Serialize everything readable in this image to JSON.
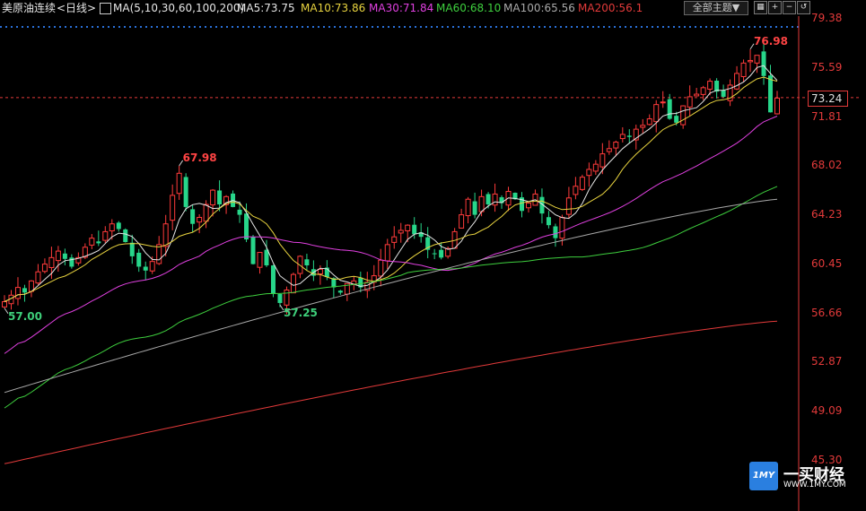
{
  "header": {
    "instrument": "美原油连续",
    "period": "<日线>",
    "ma_label": "MA(5,10,30,60,100,200)",
    "ma_values": [
      {
        "text": "MA5:73.75",
        "color": "#e6e6e6"
      },
      {
        "text": "MA10:73.86",
        "color": "#e8d33f"
      },
      {
        "text": "MA30:71.84",
        "color": "#e040e0"
      },
      {
        "text": "MA60:68.10",
        "color": "#3ecf3e"
      },
      {
        "text": "MA100:65.56",
        "color": "#a8a8a8"
      },
      {
        "text": "MA200:56.1",
        "color": "#e23a3a"
      }
    ],
    "theme_button": "全部主题▼",
    "tool_icons": [
      "grid-icon",
      "zoom-in-icon",
      "zoom-out-icon",
      "reset-icon"
    ]
  },
  "chart_data": {
    "type": "candlestick",
    "y_axis": {
      "ticks": [
        "79.38",
        "75.59",
        "71.81",
        "68.02",
        "64.23",
        "60.45",
        "56.66",
        "52.87",
        "49.09",
        "45.30"
      ],
      "range": [
        45.3,
        79.38
      ]
    },
    "current_price": "73.24",
    "current_value": 73.24,
    "annotations": [
      {
        "label": "76.98",
        "value": 76.98,
        "color": "#ff4444"
      },
      {
        "label": "67.98",
        "value": 67.98,
        "color": "#ff4444"
      },
      {
        "label": "57.25",
        "value": 57.25,
        "color": "#3ecf7a"
      },
      {
        "label": "57.00",
        "value": 57.0,
        "color": "#3ecf7a"
      }
    ],
    "up_color": "#ff3b3b",
    "down_color": "#27d68a",
    "closes": [
      57.5,
      58.0,
      58.6,
      58.2,
      59.1,
      59.8,
      60.4,
      60.9,
      61.4,
      60.8,
      60.2,
      60.9,
      61.7,
      62.4,
      62.0,
      62.9,
      63.5,
      63.1,
      62.1,
      61.0,
      60.2,
      59.9,
      60.6,
      61.9,
      63.5,
      65.7,
      67.4,
      64.8,
      63.5,
      64.0,
      65.0,
      66.1,
      65.0,
      65.6,
      64.8,
      64.2,
      62.3,
      60.4,
      61.3,
      60.3,
      58.1,
      57.4,
      58.4,
      59.6,
      61.0,
      60.3,
      59.5,
      60.0,
      59.4,
      58.6,
      58.2,
      58.9,
      59.1,
      58.6,
      59.0,
      59.5,
      60.7,
      61.9,
      62.5,
      63.0,
      63.4,
      62.7,
      62.5,
      61.5,
      61.2,
      60.9,
      61.6,
      62.9,
      64.2,
      65.4,
      64.2,
      65.6,
      65.0,
      65.8,
      65.1,
      66.0,
      65.4,
      64.5,
      65.1,
      65.8,
      64.3,
      63.4,
      62.4,
      64.0,
      65.5,
      66.4,
      67.1,
      67.7,
      68.1,
      68.9,
      69.3,
      69.8,
      70.4,
      70.2,
      70.8,
      71.1,
      71.6,
      72.7,
      72.9,
      71.6,
      71.3,
      72.6,
      73.3,
      73.5,
      74.0,
      74.5,
      73.7,
      73.3,
      74.2,
      75.1,
      75.9,
      76.1,
      76.5,
      74.9,
      72.1,
      73.2
    ],
    "ma_lines": [
      {
        "name": "MA5",
        "color": "#e6e6e6",
        "period": 5
      },
      {
        "name": "MA10",
        "color": "#e8d33f",
        "period": 10
      },
      {
        "name": "MA30",
        "color": "#e040e0",
        "period": 30
      },
      {
        "name": "MA60",
        "color": "#3ecf3e",
        "period": 60
      }
    ],
    "long_mas": [
      {
        "name": "MA100",
        "color": "#a8a8a8",
        "start": 50.5,
        "end": 65.4
      },
      {
        "name": "MA200",
        "color": "#e23a3a",
        "start": 45.0,
        "end": 56.0
      }
    ]
  },
  "logo": {
    "badge": "1MY",
    "name": "一买财经",
    "url": "WWW.1MY.COM"
  }
}
